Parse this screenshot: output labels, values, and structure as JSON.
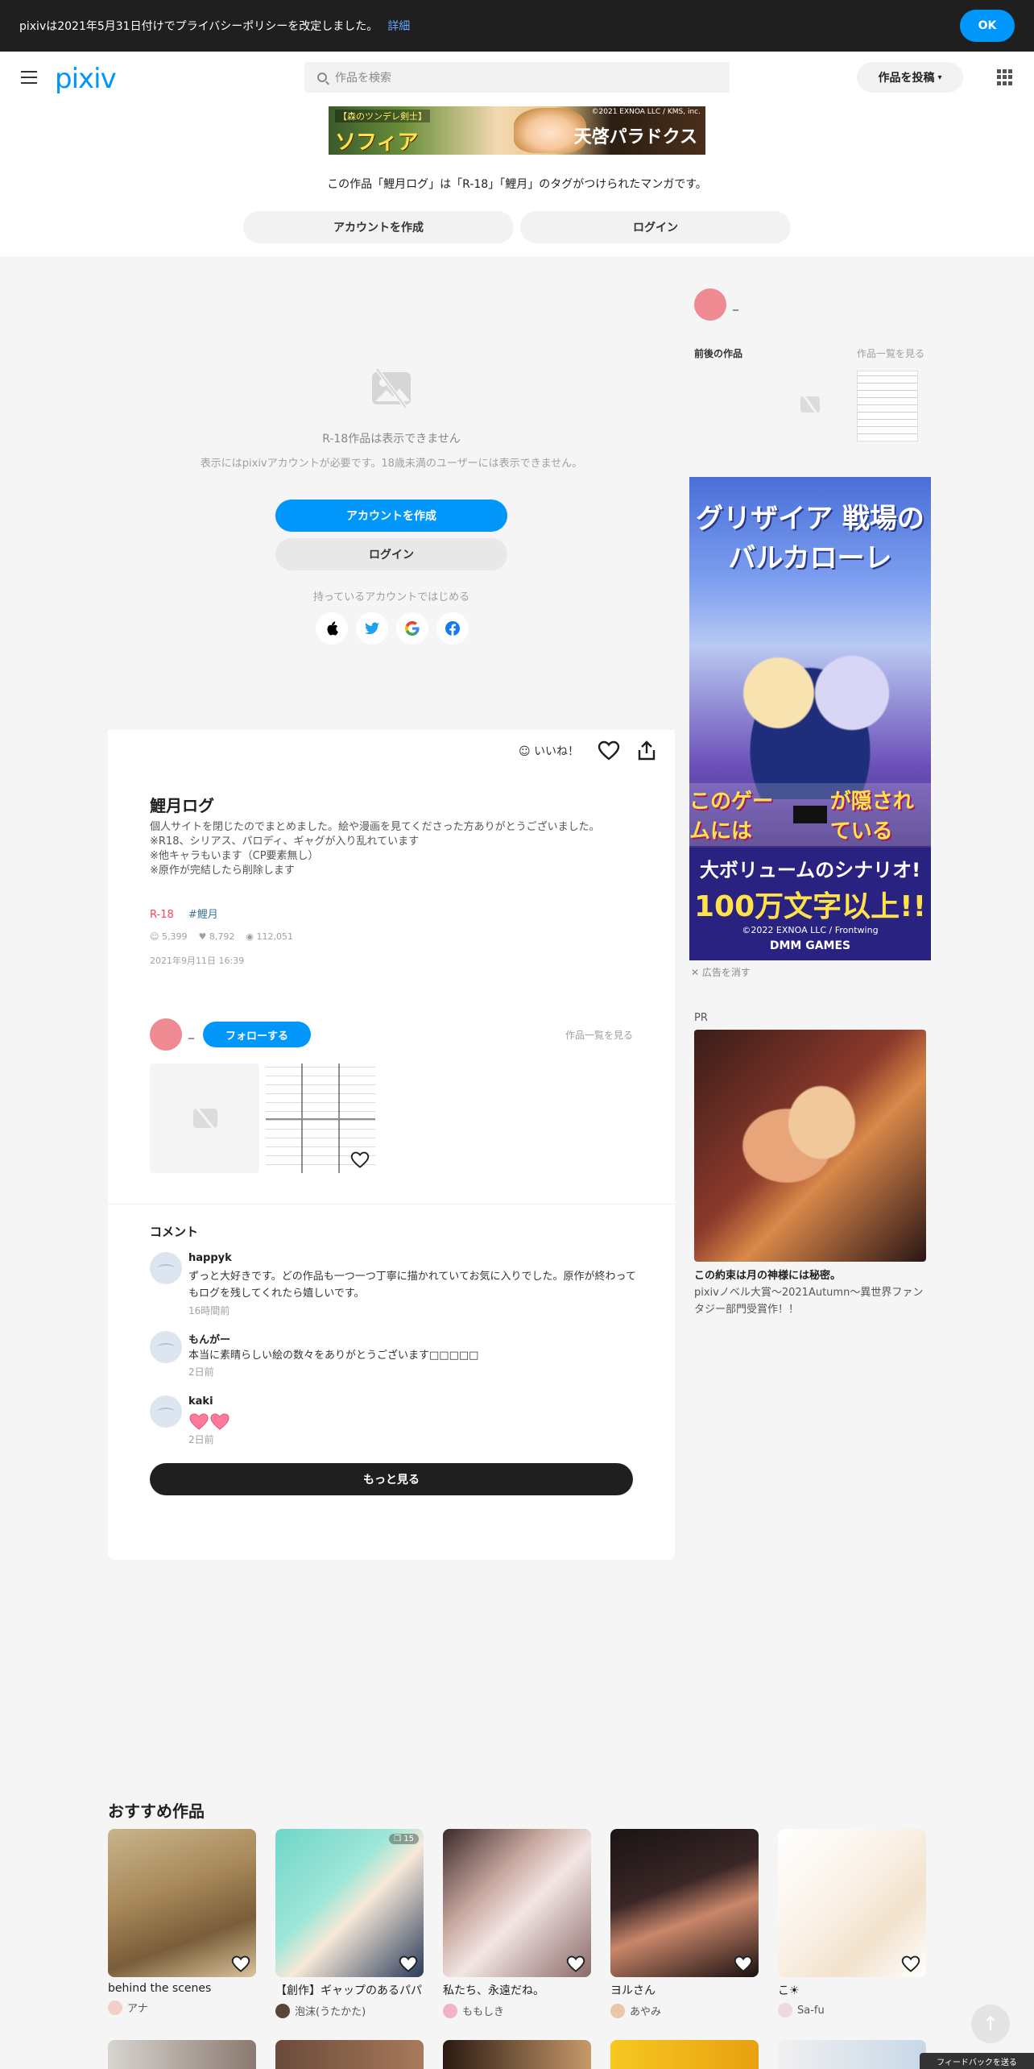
{
  "notice": {
    "text": "pixivは2021年5月31日付けでプライバシーポリシーを改定しました。",
    "link": "詳細",
    "ok": "OK"
  },
  "header": {
    "logo": "pixiv",
    "search_placeholder": "作品を検索",
    "post_button": "作品を投稿",
    "ad": {
      "line1": "【森のツンデレ剣士】",
      "line2": "ソフィア",
      "line3": "©2021 EXNOA LLC / KMS, inc.",
      "line4": "天啓パラドクス"
    },
    "tag_notice": "この作品「鯉月ログ」は「R-18」「鯉月」のタグがつけられたマンガです。",
    "create_account": "アカウントを作成",
    "login": "ログイン"
  },
  "restricted": {
    "title": "R-18作品は表示できません",
    "description": "表示にはpixivアカウントが必要です。18歳未満のユーザーには表示できません。",
    "create_account": "アカウントを作成",
    "login": "ログイン",
    "existing_account": "持っているアカウントではじめる",
    "socials": [
      "apple",
      "twitter",
      "google",
      "facebook"
    ]
  },
  "work": {
    "like_label": "いいね！",
    "title": "鯉月ログ",
    "description": [
      "個人サイトを閉じたのでまとめました。絵や漫画を見てくださった方ありがとうございました。",
      "※R18、シリアス、パロディ、ギャグが入り乱れています",
      "※他キャラもいます（CP要素無し）",
      "※原作が完結したら削除します"
    ],
    "tags": [
      "R-18",
      "#鯉月"
    ],
    "stats": {
      "likes": "5,399",
      "bookmarks": "8,792",
      "views": "112,051"
    },
    "date": "2021年9月11日 16:39"
  },
  "author": {
    "name": "_",
    "follow": "フォローする",
    "see_all": "作品一覧を見る"
  },
  "comments": {
    "title": "コメント",
    "items": [
      {
        "name": "happyk",
        "text": "ずっと大好きです。どの作品も一つ一つ丁寧に描かれていてお気に入りでした。原作が終わってもログを残してくれたら嬉しいです。",
        "time": "16時間前"
      },
      {
        "name": "もんがー",
        "text": "本当に素晴らしい絵の数々をありがとうございます□□□□□",
        "time": "2日前"
      },
      {
        "name": "kaki",
        "text": "",
        "time": "2日前"
      }
    ],
    "more": "もっと見る"
  },
  "sidebar": {
    "author_name": "_",
    "prev_next": "前後の作品",
    "see_all": "作品一覧を見る",
    "ad": {
      "title": "グリザイア 戦場のバルカローレ",
      "tagline_a": "このゲームには",
      "tagline_b": "が隠されている",
      "banner_a": "大ボリュームのシナリオ!",
      "banner_b": "100万文字以上!!",
      "copyright": "©2022 EXNOA LLC / Frontwing",
      "brand": "DMM GAMES"
    },
    "hide_ad": "広告を消す",
    "pr_label": "PR",
    "pr_title": "この約束は月の神様には秘密。",
    "pr_desc": "pixivノベル大賞～2021Autumn～異世界ファンタジー部門受賞作！！"
  },
  "recommended": {
    "title": "おすすめ作品",
    "items": [
      {
        "name": "behind the scenes",
        "author": "アナ",
        "pages": ""
      },
      {
        "name": "【創作】ギャップのあるパパ",
        "author": "泡沫(うたかた)",
        "pages": "15"
      },
      {
        "name": "私たち、永遠だね。",
        "author": "ももしき",
        "pages": ""
      },
      {
        "name": "ヨルさん",
        "author": "あやみ",
        "pages": ""
      },
      {
        "name": "こ☀",
        "author": "Sa-fu",
        "pages": ""
      }
    ]
  },
  "feedback": "フィードバックを送る",
  "colors": {
    "accent": "#0096fa",
    "r18": "#ff4060",
    "tag": "#3d7699"
  }
}
